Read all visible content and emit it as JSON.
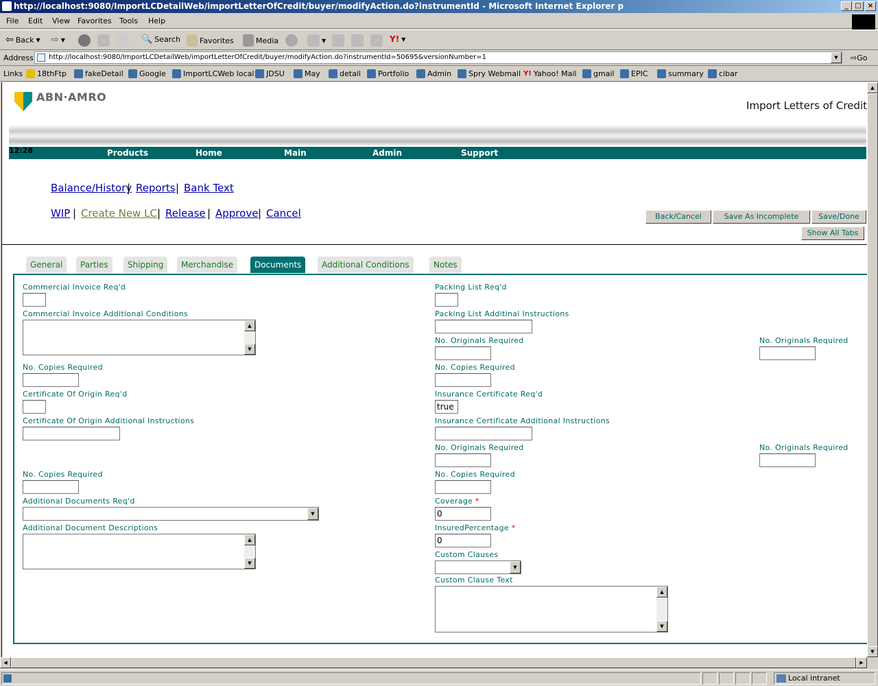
{
  "browser": {
    "title": "http://localhost:9080/ImportLCDetailWeb/importLetterOfCredit/buyer/modifyAction.do?instrumentId - Microsoft Internet Explorer p",
    "menu": [
      "File",
      "Edit",
      "View",
      "Favorites",
      "Tools",
      "Help"
    ],
    "toolbar": {
      "back": "Back",
      "search": "Search",
      "favorites": "Favorites",
      "media": "Media"
    },
    "address_label": "Address",
    "address": "http://localhost:9080/ImportLCDetailWeb/importLetterOfCredit/buyer/modifyAction.do?instrumentId=50695&versionNumber=1",
    "go": "Go",
    "links_label": "Links",
    "links": [
      "18thFtp",
      "fakeDetail",
      "Google",
      "ImportLCWeb local",
      "JDSU",
      "May",
      "detail",
      "Portfolio",
      "Admin",
      "Spry Webmail",
      "Yahoo! Mail",
      "gmail",
      "EPIC",
      "summary",
      "cibar"
    ],
    "status": "Local intranet"
  },
  "header": {
    "logo": "ABN·AMRO",
    "title": "Import Letters of Credit",
    "clock": "12:28",
    "nav": [
      "Products",
      "Home",
      "Main",
      "Admin",
      "Support"
    ]
  },
  "links_row1": [
    "Balance/History",
    "Reports",
    "Bank Text"
  ],
  "links_row2": [
    "WIP",
    "Create New LC",
    "Release",
    "Approve",
    "Cancel"
  ],
  "buttons": {
    "back_cancel": "Back/Cancel",
    "save_incomplete": "Save As Incomplete",
    "save_done": "Save/Done",
    "show_all": "Show All Tabs"
  },
  "tabs": [
    "General",
    "Parties",
    "Shipping",
    "Merchandise",
    "Documents",
    "Additional Conditions",
    "Notes"
  ],
  "active_tab": "Documents",
  "form": {
    "comm_inv_req": "Commercial Invoice Req'd",
    "comm_inv_add": "Commercial Invoice Additional Conditions",
    "copies_req": "No. Copies Required",
    "cert_origin_req": "Certificate Of Origin Req'd",
    "cert_origin_add": "Certificate Of Origin Additional Instructions",
    "add_docs_req": "Additional Documents Req'd",
    "add_doc_desc": "Additional Document Descriptions",
    "packing_req": "Packing List Req'd",
    "packing_add": "Packing List Additinal Instructions",
    "originals_req": "No. Originals Required",
    "ins_cert_req": "Insurance Certificate Req'd",
    "ins_cert_value": "true",
    "ins_cert_add": "Insurance Certificate Additional Instructions",
    "coverage": "Coverage",
    "coverage_value": "0",
    "insured_pct": "InsuredPercentage",
    "insured_pct_value": "0",
    "custom_clauses": "Custom Clauses",
    "custom_clause_text": "Custom Clause Text",
    "required_mark": "*"
  }
}
